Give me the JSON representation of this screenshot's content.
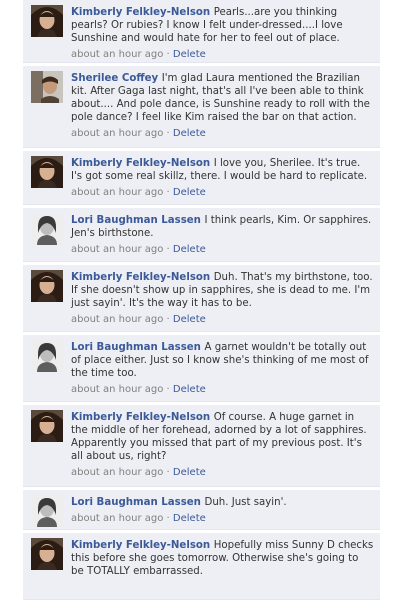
{
  "comments": [
    {
      "author": "Kimberly Felkley-Nelson",
      "avatar": "kimberly",
      "text": "Pearls...are you thinking pearls? Or rubies? I know I felt under-dressed....I love Sunshine and would hate for her to feel out of place.",
      "time": "about an hour ago",
      "separator": "·",
      "delete": "Delete"
    },
    {
      "author": "Sherilee Coffey",
      "avatar": "sherilee",
      "text": "I'm glad Laura mentioned the Brazilian kit. After Gaga last night, that's all I've been able to think about.... And pole dance, is Sunshine ready to roll with the pole dance? I feel like Kim raised the bar on that action.",
      "time": "about an hour ago",
      "separator": "·",
      "delete": "Delete"
    },
    {
      "author": "Kimberly Felkley-Nelson",
      "avatar": "kimberly",
      "text": "I love you, Sherilee. It's true. I's got some real skillz, there. I would be hard to replicate.",
      "time": "about an hour ago",
      "separator": "·",
      "delete": "Delete"
    },
    {
      "author": "Lori Baughman Lassen",
      "avatar": "lori",
      "text": "I think pearls, Kim. Or sapphires. Jen's birthstone.",
      "time": "about an hour ago",
      "separator": "·",
      "delete": "Delete"
    },
    {
      "author": "Kimberly Felkley-Nelson",
      "avatar": "kimberly",
      "text": "Duh. That's my birthstone, too. If she doesn't show up in sapphires, she is dead to me. I'm just sayin'. It's the way it has to be.",
      "time": "about an hour ago",
      "separator": "·",
      "delete": "Delete"
    },
    {
      "author": "Lori Baughman Lassen",
      "avatar": "lori",
      "text": "A garnet wouldn't be totally out of place either. Just so I know she's thinking of me most of the time too.",
      "time": "about an hour ago",
      "separator": "·",
      "delete": "Delete"
    },
    {
      "author": "Kimberly Felkley-Nelson",
      "avatar": "kimberly",
      "text": "Of course. A huge garnet in the middle of her forehead, adorned by a lot of sapphires. Apparently you missed that part of my previous post. It's all about us, right?",
      "time": "about an hour ago",
      "separator": "·",
      "delete": "Delete"
    },
    {
      "author": "Lori Baughman Lassen",
      "avatar": "lori",
      "text": "Duh. Just sayin'.",
      "time": "about an hour ago",
      "separator": "·",
      "delete": "Delete"
    },
    {
      "author": "Kimberly Felkley-Nelson",
      "avatar": "kimberly",
      "text": "Hopefully miss Sunny D checks this before she goes tomorrow. Otherwise she's going to be TOTALLY embarrassed.",
      "time": "",
      "separator": "",
      "delete": ""
    }
  ]
}
